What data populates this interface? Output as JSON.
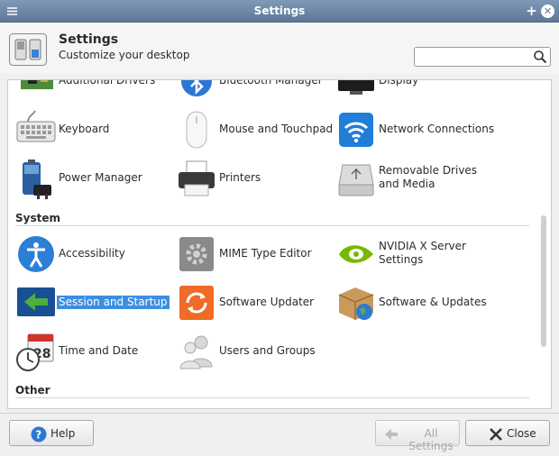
{
  "window": {
    "title": "Settings"
  },
  "header": {
    "title": "Settings",
    "subtitle": "Customize your desktop"
  },
  "search": {
    "value": "",
    "placeholder": ""
  },
  "content": {
    "partial_row": [
      "Additional Drivers",
      "Bluetooth Manager",
      "Display"
    ],
    "hardware_items": [
      {
        "label": "Keyboard",
        "icon": "keyboard-icon"
      },
      {
        "label": "Mouse and Touchpad",
        "icon": "mouse-icon"
      },
      {
        "label": "Network Connections",
        "icon": "wifi-icon"
      },
      {
        "label": "Power Manager",
        "icon": "battery-icon"
      },
      {
        "label": "Printers",
        "icon": "printer-icon"
      },
      {
        "label": "Removable Drives and Media",
        "icon": "drive-icon"
      }
    ],
    "system_heading": "System",
    "system_items": [
      {
        "label": "Accessibility",
        "icon": "accessibility-icon"
      },
      {
        "label": "MIME Type Editor",
        "icon": "gear-icon"
      },
      {
        "label": "NVIDIA X Server Settings",
        "icon": "nvidia-icon"
      },
      {
        "label": "Session and Startup",
        "icon": "session-icon",
        "selected": true
      },
      {
        "label": "Software Updater",
        "icon": "refresh-icon"
      },
      {
        "label": "Software & Updates",
        "icon": "package-icon"
      },
      {
        "label": "Time and Date",
        "icon": "clock-icon"
      },
      {
        "label": "Users and Groups",
        "icon": "users-icon"
      }
    ],
    "other_heading": "Other"
  },
  "footer": {
    "help": "Help",
    "all_settings": "All Settings",
    "close": "Close"
  },
  "colors": {
    "titlebar": "#6c87a5",
    "selection": "#3d8ee0"
  }
}
